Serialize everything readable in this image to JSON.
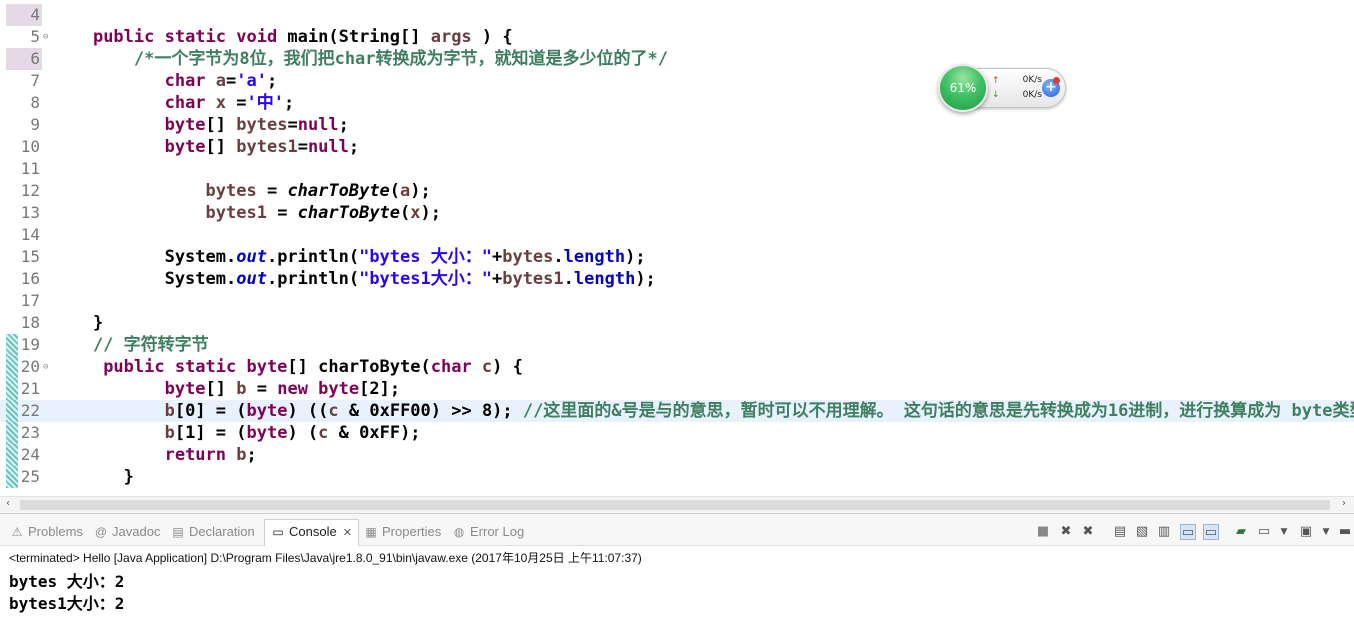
{
  "editor": {
    "lines": [
      {
        "num": "4",
        "segments": [
          {
            "t": "",
            "c": ""
          }
        ]
      },
      {
        "num": "5",
        "fold": true,
        "segments": [
          {
            "t": "    ",
            "c": ""
          },
          {
            "t": "public static void",
            "c": "k"
          },
          {
            "t": " main(String[] ",
            "c": ""
          },
          {
            "t": "args",
            "c": "v"
          },
          {
            "t": " ) {",
            "c": ""
          }
        ]
      },
      {
        "num": "6",
        "segments": [
          {
            "t": "        /*一个字节为8位，我们把char转换成为字节，就知道是多少位的了*/",
            "c": "c"
          }
        ]
      },
      {
        "num": "7",
        "segments": [
          {
            "t": "           ",
            "c": ""
          },
          {
            "t": "char",
            "c": "k"
          },
          {
            "t": " ",
            "c": ""
          },
          {
            "t": "a",
            "c": "v"
          },
          {
            "t": "=",
            "c": ""
          },
          {
            "t": "'a'",
            "c": "s"
          },
          {
            "t": ";",
            "c": ""
          }
        ]
      },
      {
        "num": "8",
        "segments": [
          {
            "t": "           ",
            "c": ""
          },
          {
            "t": "char",
            "c": "k"
          },
          {
            "t": " ",
            "c": ""
          },
          {
            "t": "x",
            "c": "v"
          },
          {
            "t": " =",
            "c": ""
          },
          {
            "t": "'中'",
            "c": "s"
          },
          {
            "t": ";",
            "c": ""
          }
        ]
      },
      {
        "num": "9",
        "segments": [
          {
            "t": "           ",
            "c": ""
          },
          {
            "t": "byte",
            "c": "k"
          },
          {
            "t": "[] ",
            "c": ""
          },
          {
            "t": "bytes",
            "c": "v"
          },
          {
            "t": "=",
            "c": ""
          },
          {
            "t": "null",
            "c": "k"
          },
          {
            "t": ";",
            "c": ""
          }
        ]
      },
      {
        "num": "10",
        "segments": [
          {
            "t": "           ",
            "c": ""
          },
          {
            "t": "byte",
            "c": "k"
          },
          {
            "t": "[] ",
            "c": ""
          },
          {
            "t": "bytes1",
            "c": "v"
          },
          {
            "t": "=",
            "c": ""
          },
          {
            "t": "null",
            "c": "k"
          },
          {
            "t": ";",
            "c": ""
          }
        ]
      },
      {
        "num": "11",
        "segments": [
          {
            "t": "",
            "c": ""
          }
        ]
      },
      {
        "num": "12",
        "segments": [
          {
            "t": "               ",
            "c": ""
          },
          {
            "t": "bytes",
            "c": "v"
          },
          {
            "t": " = ",
            "c": ""
          },
          {
            "t": "charToByte",
            "c": "it"
          },
          {
            "t": "(",
            "c": ""
          },
          {
            "t": "a",
            "c": "v"
          },
          {
            "t": ");",
            "c": ""
          }
        ]
      },
      {
        "num": "13",
        "segments": [
          {
            "t": "               ",
            "c": ""
          },
          {
            "t": "bytes1",
            "c": "v"
          },
          {
            "t": " = ",
            "c": ""
          },
          {
            "t": "charToByte",
            "c": "it"
          },
          {
            "t": "(",
            "c": ""
          },
          {
            "t": "x",
            "c": "v"
          },
          {
            "t": ");",
            "c": ""
          }
        ]
      },
      {
        "num": "14",
        "segments": [
          {
            "t": "",
            "c": ""
          }
        ]
      },
      {
        "num": "15",
        "segments": [
          {
            "t": "           System.",
            "c": ""
          },
          {
            "t": "out",
            "c": "f"
          },
          {
            "t": ".println(",
            "c": ""
          },
          {
            "t": "\"bytes 大小：\"",
            "c": "s"
          },
          {
            "t": "+",
            "c": ""
          },
          {
            "t": "bytes",
            "c": "v"
          },
          {
            "t": ".",
            "c": ""
          },
          {
            "t": "length",
            "c": "fld"
          },
          {
            "t": ");",
            "c": ""
          }
        ]
      },
      {
        "num": "16",
        "segments": [
          {
            "t": "           System.",
            "c": ""
          },
          {
            "t": "out",
            "c": "f"
          },
          {
            "t": ".println(",
            "c": ""
          },
          {
            "t": "\"bytes1大小：\"",
            "c": "s"
          },
          {
            "t": "+",
            "c": ""
          },
          {
            "t": "bytes1",
            "c": "v"
          },
          {
            "t": ".",
            "c": ""
          },
          {
            "t": "length",
            "c": "fld"
          },
          {
            "t": ");",
            "c": ""
          }
        ]
      },
      {
        "num": "17",
        "segments": [
          {
            "t": "",
            "c": ""
          }
        ]
      },
      {
        "num": "18",
        "segments": [
          {
            "t": "    }",
            "c": ""
          }
        ]
      },
      {
        "num": "19",
        "changed": true,
        "segments": [
          {
            "t": "    // 字符转字节",
            "c": "c"
          }
        ]
      },
      {
        "num": "20",
        "changed": true,
        "fold": true,
        "segments": [
          {
            "t": "     ",
            "c": ""
          },
          {
            "t": "public static byte",
            "c": "k"
          },
          {
            "t": "[] charToByte(",
            "c": ""
          },
          {
            "t": "char",
            "c": "k"
          },
          {
            "t": " ",
            "c": ""
          },
          {
            "t": "c",
            "c": "v"
          },
          {
            "t": ") {",
            "c": ""
          }
        ]
      },
      {
        "num": "21",
        "changed": true,
        "segments": [
          {
            "t": "           ",
            "c": ""
          },
          {
            "t": "byte",
            "c": "k"
          },
          {
            "t": "[] ",
            "c": ""
          },
          {
            "t": "b",
            "c": "v"
          },
          {
            "t": " = ",
            "c": ""
          },
          {
            "t": "new byte",
            "c": "k"
          },
          {
            "t": "[2];",
            "c": ""
          }
        ]
      },
      {
        "num": "22",
        "changed": true,
        "current": true,
        "segments": [
          {
            "t": "           ",
            "c": ""
          },
          {
            "t": "b",
            "c": "v"
          },
          {
            "t": "[0] = (",
            "c": ""
          },
          {
            "t": "byte",
            "c": "k"
          },
          {
            "t": ") ((",
            "c": ""
          },
          {
            "t": "c",
            "c": "v"
          },
          {
            "t": " & 0xFF00) >> 8); ",
            "c": ""
          },
          {
            "t": "//这里面的&号是与的意思，暂时可以不用理解。 这句话的意思是先转换成为16进制，进行换算成为 byte类型",
            "c": "c"
          }
        ]
      },
      {
        "num": "23",
        "changed": true,
        "segments": [
          {
            "t": "           ",
            "c": ""
          },
          {
            "t": "b",
            "c": "v"
          },
          {
            "t": "[1] = (",
            "c": ""
          },
          {
            "t": "byte",
            "c": "k"
          },
          {
            "t": ") (",
            "c": ""
          },
          {
            "t": "c",
            "c": "v"
          },
          {
            "t": " & 0xFF);",
            "c": ""
          }
        ]
      },
      {
        "num": "24",
        "changed": true,
        "segments": [
          {
            "t": "           ",
            "c": ""
          },
          {
            "t": "return",
            "c": "k"
          },
          {
            "t": " ",
            "c": ""
          },
          {
            "t": "b",
            "c": "v"
          },
          {
            "t": ";",
            "c": ""
          }
        ]
      },
      {
        "num": "25",
        "changed": true,
        "segments": [
          {
            "t": "       }",
            "c": ""
          }
        ]
      }
    ]
  },
  "netmon": {
    "percent": "61%",
    "upload": "0K/s",
    "download": "0K/s"
  },
  "views": {
    "tabs": [
      {
        "label": "Problems",
        "icon": "⚠"
      },
      {
        "label": "Javadoc",
        "icon": "@"
      },
      {
        "label": "Declaration",
        "icon": "▤"
      },
      {
        "label": "Console",
        "icon": "▭"
      },
      {
        "label": "Properties",
        "icon": "▦"
      },
      {
        "label": "Error Log",
        "icon": "◍"
      }
    ],
    "status": "<terminated> Hello [Java Application] D:\\Program Files\\Java\\jre1.8.0_91\\bin\\javaw.exe (2017年10月25日 上午11:07:37)",
    "output": [
      "bytes 大小：2",
      "bytes1大小：2"
    ]
  }
}
